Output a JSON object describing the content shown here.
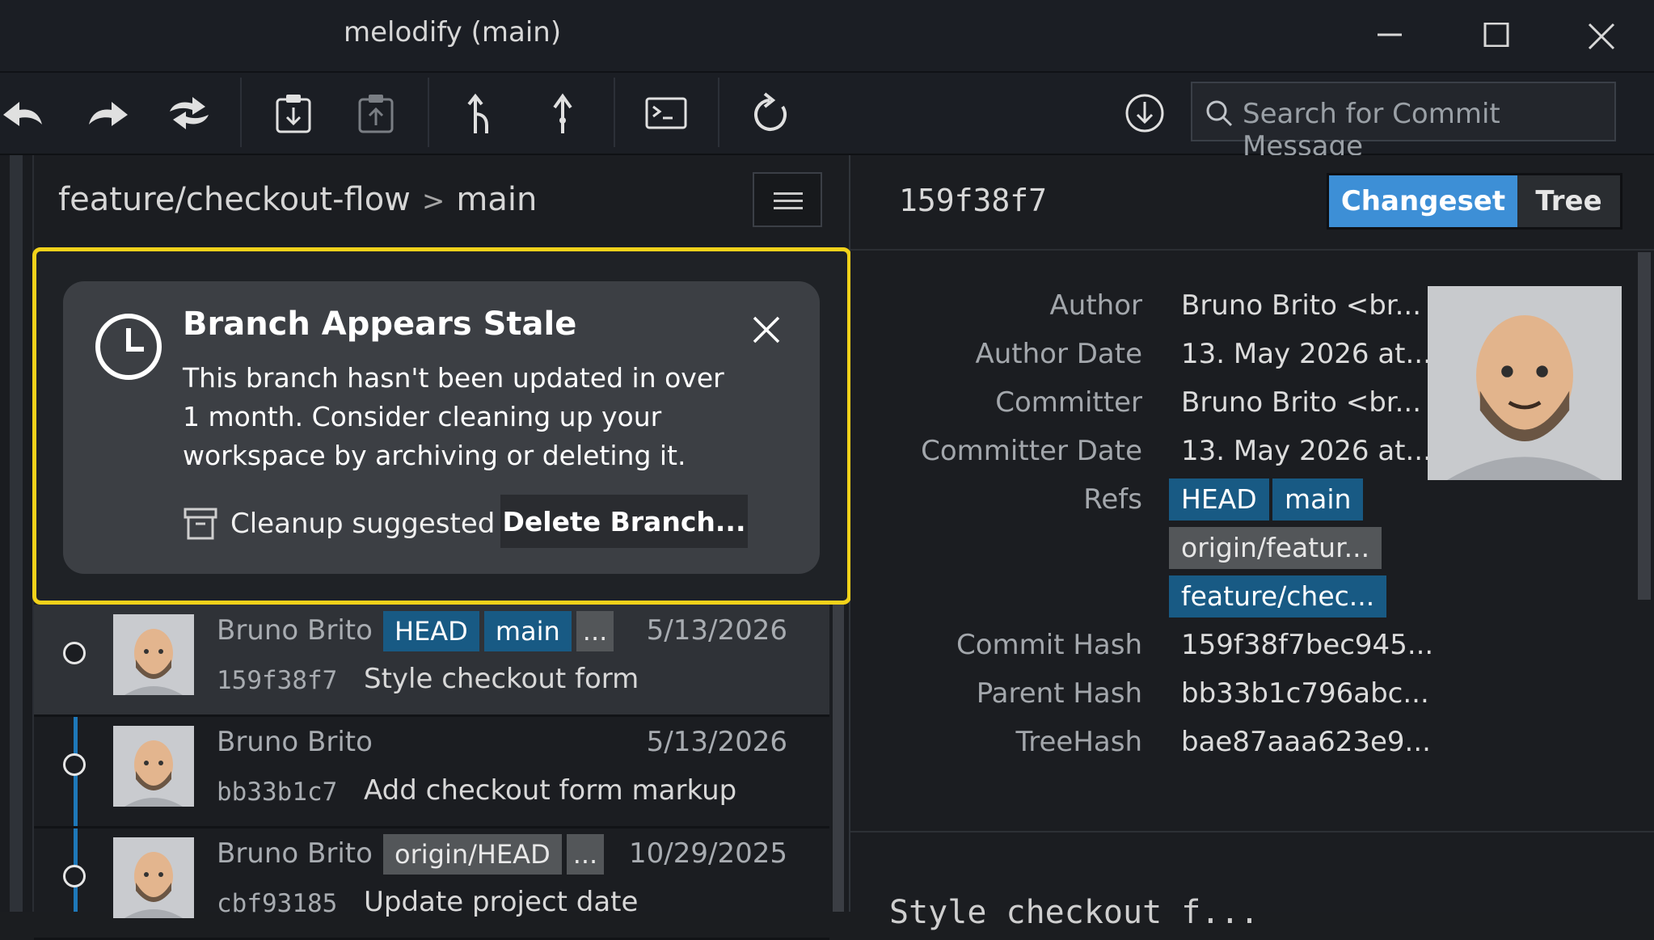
{
  "window": {
    "title": "melodify (main)"
  },
  "toolbar": {
    "search_placeholder": "Search for Commit Message",
    "buttons": [
      "undo-icon",
      "redo-icon",
      "sync-icon",
      "stash-icon",
      "pop-stash-icon",
      "branch-icon",
      "push-icon",
      "terminal-icon",
      "refresh-icon",
      "fetch-icon"
    ]
  },
  "breadcrumb": {
    "branch": "feature/checkout-flow",
    "separator": ">",
    "target": "main"
  },
  "notification": {
    "title": "Branch Appears Stale",
    "body": "This branch hasn't been updated in over 1 month. Consider cleaning up your workspace by archiving or deleting it.",
    "footer_label": "Cleanup suggested",
    "action_label": "Delete Branch..."
  },
  "commits": [
    {
      "author": "Bruno Brito",
      "date": "5/13/2026",
      "hash": "159f38f7",
      "message": "Style checkout form",
      "tags": [
        {
          "label": "HEAD",
          "kind": "blue"
        },
        {
          "label": "main",
          "kind": "blue"
        },
        {
          "label": "...",
          "kind": "gray"
        }
      ]
    },
    {
      "author": "Bruno Brito",
      "date": "5/13/2026",
      "hash": "bb33b1c7",
      "message": "Add checkout form markup",
      "tags": []
    },
    {
      "author": "Bruno Brito",
      "date": "10/29/2025",
      "hash": "cbf93185",
      "message": "Update project date",
      "tags": [
        {
          "label": "origin/HEAD",
          "kind": "gray"
        },
        {
          "label": "...",
          "kind": "gray"
        }
      ]
    }
  ],
  "details": {
    "hash": "159f38f7",
    "tabs": {
      "changeset": "Changeset",
      "tree": "Tree"
    },
    "labels": {
      "author": "Author",
      "author_date": "Author Date",
      "committer": "Committer",
      "committer_date": "Committer Date",
      "refs": "Refs",
      "commit_hash": "Commit Hash",
      "parent_hash": "Parent Hash",
      "tree_hash": "TreeHash"
    },
    "values": {
      "author": "Bruno Brito <br...",
      "author_date": "13. May 2026 at...",
      "committer": "Bruno Brito <br...",
      "committer_date": "13. May 2026 at...",
      "commit_hash": "159f38f7bec945...",
      "parent_hash": "bb33b1c796abc...",
      "tree_hash": "bae87aaa623e9..."
    },
    "refs": [
      "HEAD",
      "main",
      "origin/featur...",
      "feature/chec..."
    ],
    "message_preview": "Style checkout f..."
  },
  "colors": {
    "accent": "#3d8fd6",
    "tag_blue": "#185a84",
    "tag_gray": "#535659",
    "highlight": "#f2d21a",
    "graph": "#1e78b9"
  }
}
